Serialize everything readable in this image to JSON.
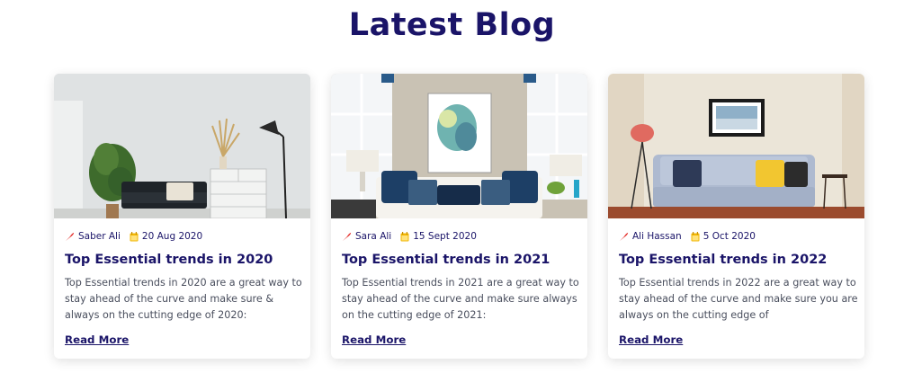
{
  "section": {
    "title": "Latest Blog"
  },
  "posts": [
    {
      "author": "Saber Ali",
      "date": "20 Aug 2020",
      "title": "Top Essential trends in 2020",
      "excerpt": "Top Essential trends in 2020 are a great way to stay ahead of the curve and make sure & always on the cutting edge of 2020:",
      "read_more": "Read More",
      "image": "living-room-dark-sofa-lamp-plant"
    },
    {
      "author": "Sara Ali",
      "date": "15 Sept 2020",
      "title": "Top Essential trends in 2021",
      "excerpt": "Top Essential trends in 2021 are a great way to stay ahead of the curve and make sure always on the cutting edge of 2021:",
      "read_more": "Read More",
      "image": "living-room-white-sofa-windows-art"
    },
    {
      "author": "Ali Hassan",
      "date": "5 Oct 2020",
      "title": "Top Essential trends in 2022",
      "excerpt": "Top Essential trends in 2022 are a great way to stay ahead of the curve and make sure you are always on the cutting edge of",
      "read_more": "Read More",
      "image": "living-room-grey-sofa-pillows"
    }
  ],
  "colors": {
    "heading": "#1a1468",
    "body_text": "#4a4f5e",
    "author_icon": "#e53935",
    "date_icon": "#f2b705"
  },
  "icons": {
    "author": "feather-pen-icon",
    "date": "calendar-icon"
  }
}
